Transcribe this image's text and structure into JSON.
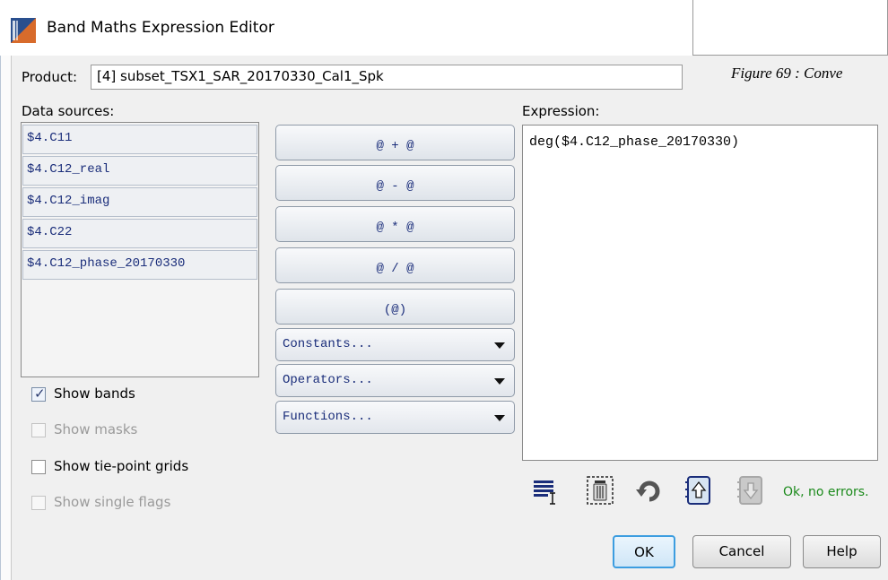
{
  "window": {
    "title": "Band Maths Expression Editor"
  },
  "overlay": {
    "caption": "Figure 69 : Conve"
  },
  "product": {
    "label": "Product:",
    "value": "[4] subset_TSX1_SAR_20170330_Cal1_Spk"
  },
  "sources": {
    "label": "Data sources:",
    "items": [
      "$4.C11",
      "$4.C12_real",
      "$4.C12_imag",
      "$4.C22",
      "$4.C12_phase_20170330"
    ]
  },
  "checkboxes": {
    "show_bands": "Show bands",
    "show_masks": "Show masks",
    "show_tie_point_grids": "Show tie-point grids",
    "show_single_flags": "Show single flags"
  },
  "operators": {
    "add": "@ + @",
    "subtract": "@ - @",
    "multiply": "@ * @",
    "divide": "@ / @",
    "parens": "(@)",
    "constants": "Constants...",
    "operators_menu": "Operators...",
    "functions": "Functions..."
  },
  "expression": {
    "label": "Expression:",
    "value": "deg($4.C12_phase_20170330)"
  },
  "toolbar": {
    "icons": [
      "select-all-icon",
      "delete-icon",
      "undo-icon",
      "history-up-icon",
      "history-down-icon"
    ]
  },
  "status": {
    "text": "Ok, no errors.",
    "color": "#1b8a1b"
  },
  "buttons": {
    "ok": "OK",
    "cancel": "Cancel",
    "help": "Help"
  },
  "colors": {
    "accent": "#3c9de0",
    "source_text": "#1a2d7a"
  }
}
